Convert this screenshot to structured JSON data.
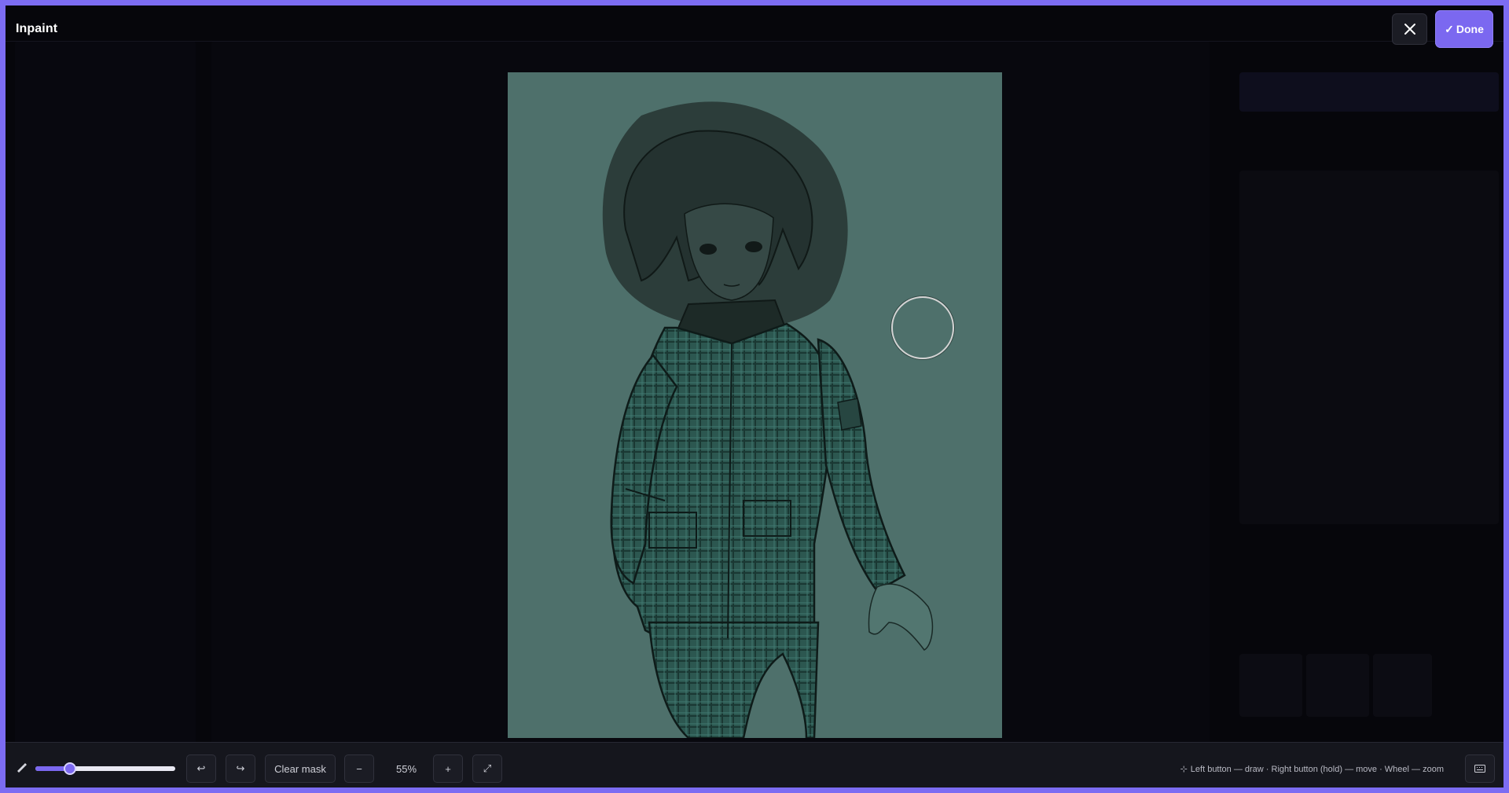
{
  "window": {
    "title": "Inpaint"
  },
  "header": {
    "close_icon": "close-icon",
    "done_label": "Done",
    "done_icon": "check-icon"
  },
  "colors": {
    "accent": "#7b68f0",
    "frame": "#7c6cf2",
    "mask_tint": "#2a3a39",
    "background": "#06060b"
  },
  "canvas": {
    "cursor": "brush-circle-cursor"
  },
  "toolbar": {
    "brush_icon": "brush-icon",
    "brush_size": 0.22,
    "undo_icon": "undo-icon",
    "redo_icon": "redo-icon",
    "clear_mask_label": "Clear mask",
    "zoom_out_label": "−",
    "zoom_level": "55%",
    "zoom_in_label": "+",
    "fit_icon": "expand-icon",
    "hint_icon": "mouse-icon",
    "hint": "Left button — draw · Right button (hold) — move · Wheel — zoom",
    "keyboard_icon": "keyboard-icon"
  }
}
